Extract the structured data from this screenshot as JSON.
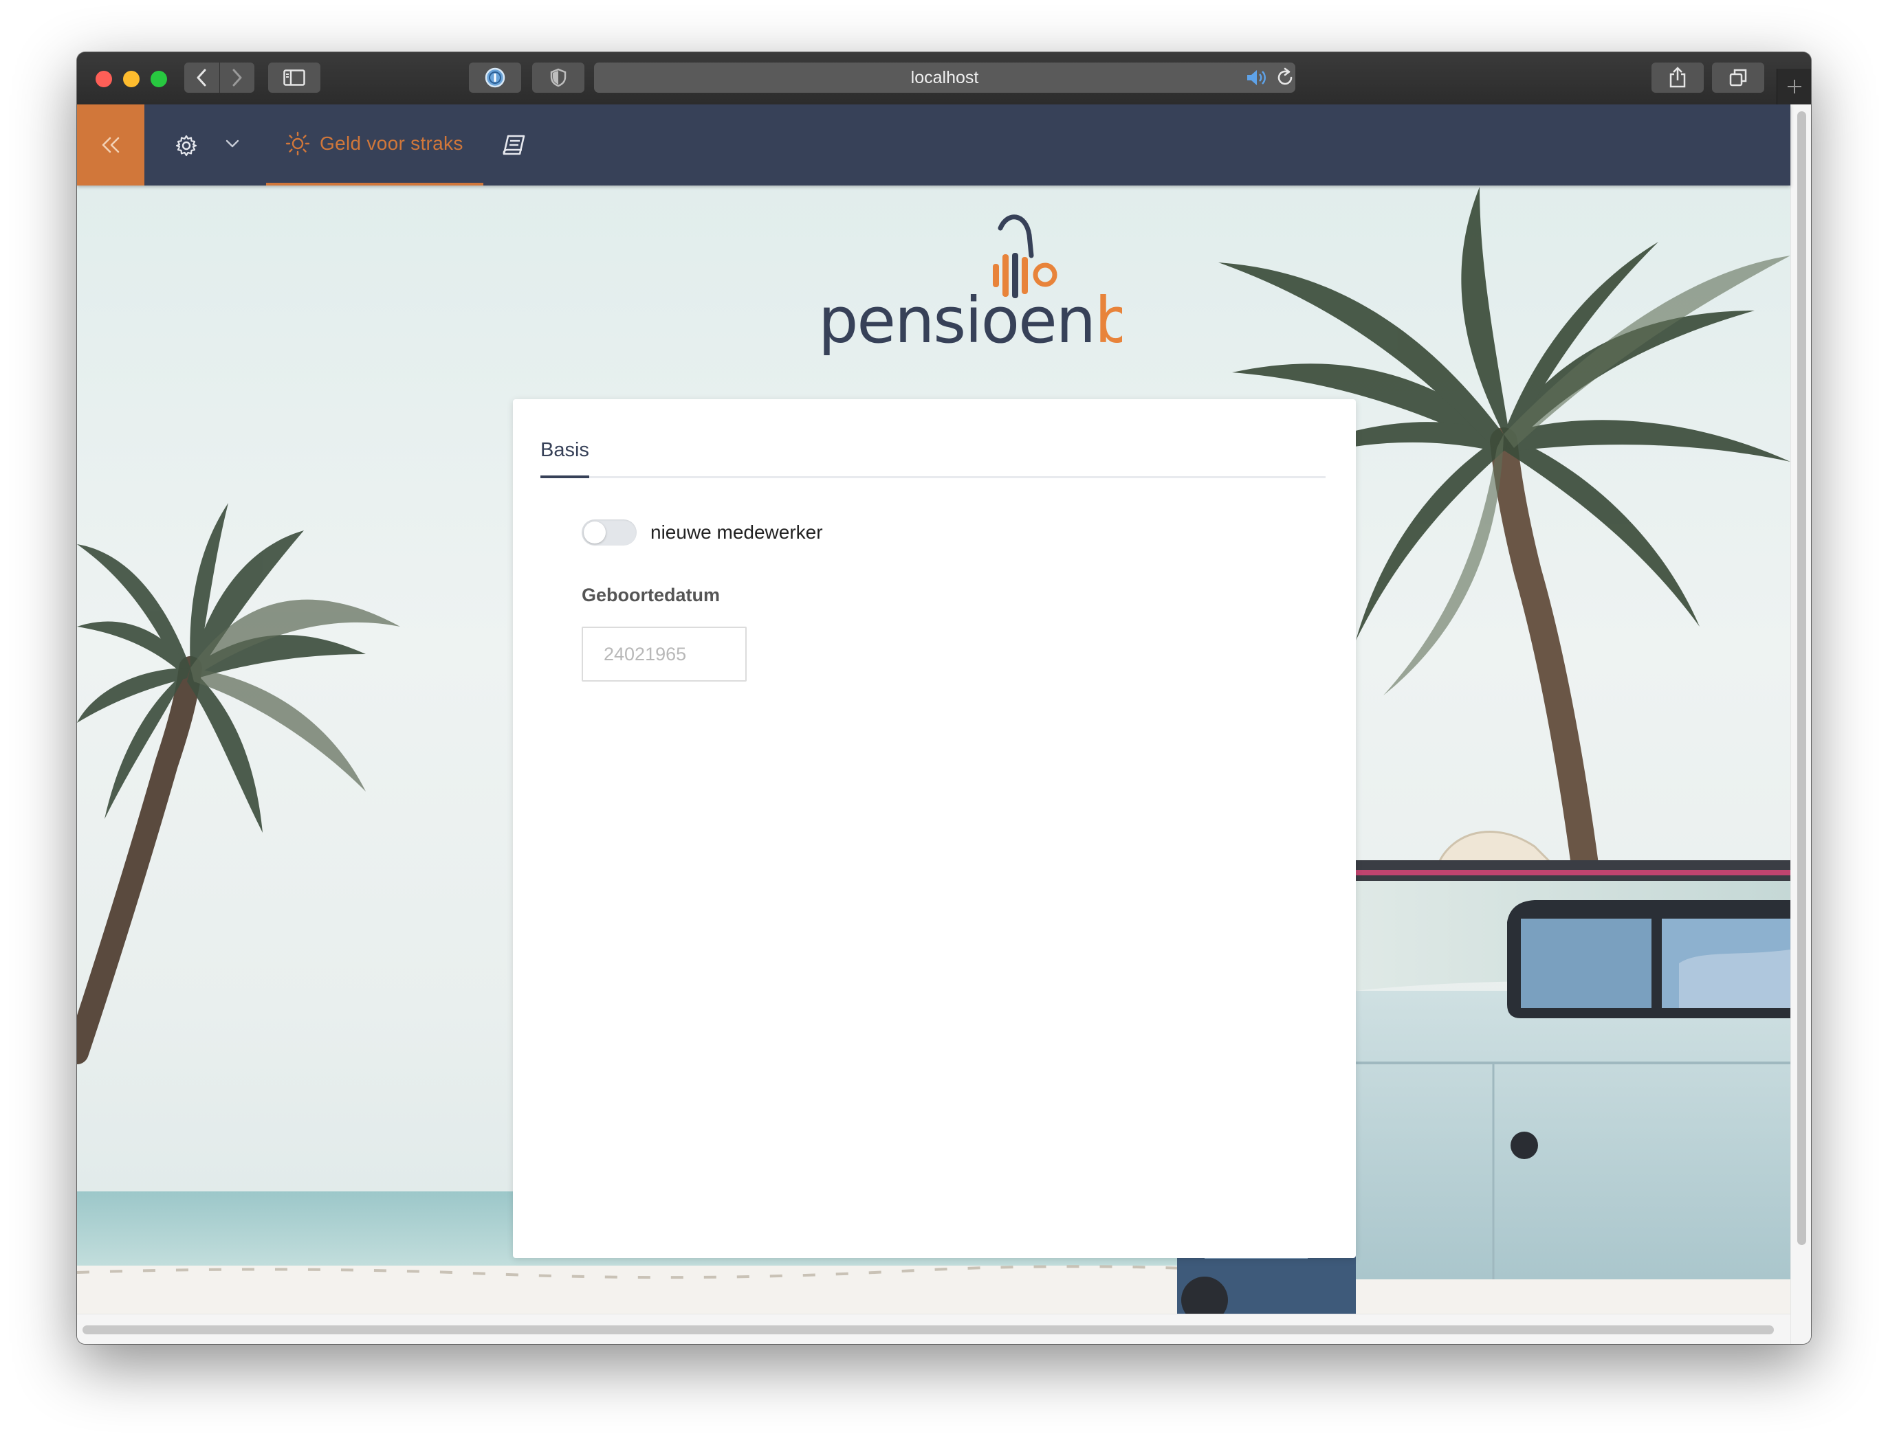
{
  "browser": {
    "url": "localhost"
  },
  "app": {
    "nav_tab_label": "Geld voor straks",
    "logo": {
      "text_main": "pensioen",
      "text_accent": "bij",
      "color_main": "#374158",
      "color_accent": "#e8833a"
    },
    "colors": {
      "nav_bg": "#374158",
      "accent": "#d1773a"
    }
  },
  "form": {
    "tab_label": "Basis",
    "toggle_label": "nieuwe medewerker",
    "toggle_on": false,
    "birthdate_label": "Geboortedatum",
    "birthdate_placeholder": "24021965",
    "birthdate_value": ""
  },
  "icons": {
    "collapse": "double-chevron-left-icon",
    "settings": "gear-icon",
    "dropdown": "chevron-down-icon",
    "tab": "sun-icon",
    "docs": "book-icon"
  }
}
